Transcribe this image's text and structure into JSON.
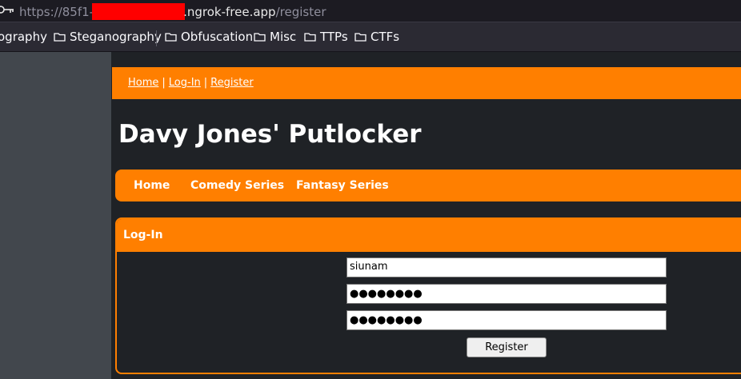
{
  "browser": {
    "url_prefix": "https://85f1-",
    "url_domain": ".ngrok-free.app",
    "url_path": "/register",
    "bookmarks": [
      "ography",
      "Steganography",
      "Obfuscation",
      "Misc",
      "TTPs",
      "CTFs"
    ]
  },
  "topbar": {
    "links": [
      "Home",
      "Log-In",
      "Register"
    ],
    "separator": "|"
  },
  "site": {
    "title": "Davy Jones' Putlocker"
  },
  "nav": {
    "items": [
      "Home",
      "Comedy Series",
      "Fantasy Series"
    ]
  },
  "login": {
    "heading": "Log-In",
    "username_value": "siunam",
    "password_value": "●●●●●●●●",
    "confirm_password_value": "●●●●●●●●",
    "submit_label": "Register"
  },
  "colors": {
    "accent": "#ff7f00",
    "page_bg": "#1f2226",
    "side_bg": "#42474d"
  }
}
